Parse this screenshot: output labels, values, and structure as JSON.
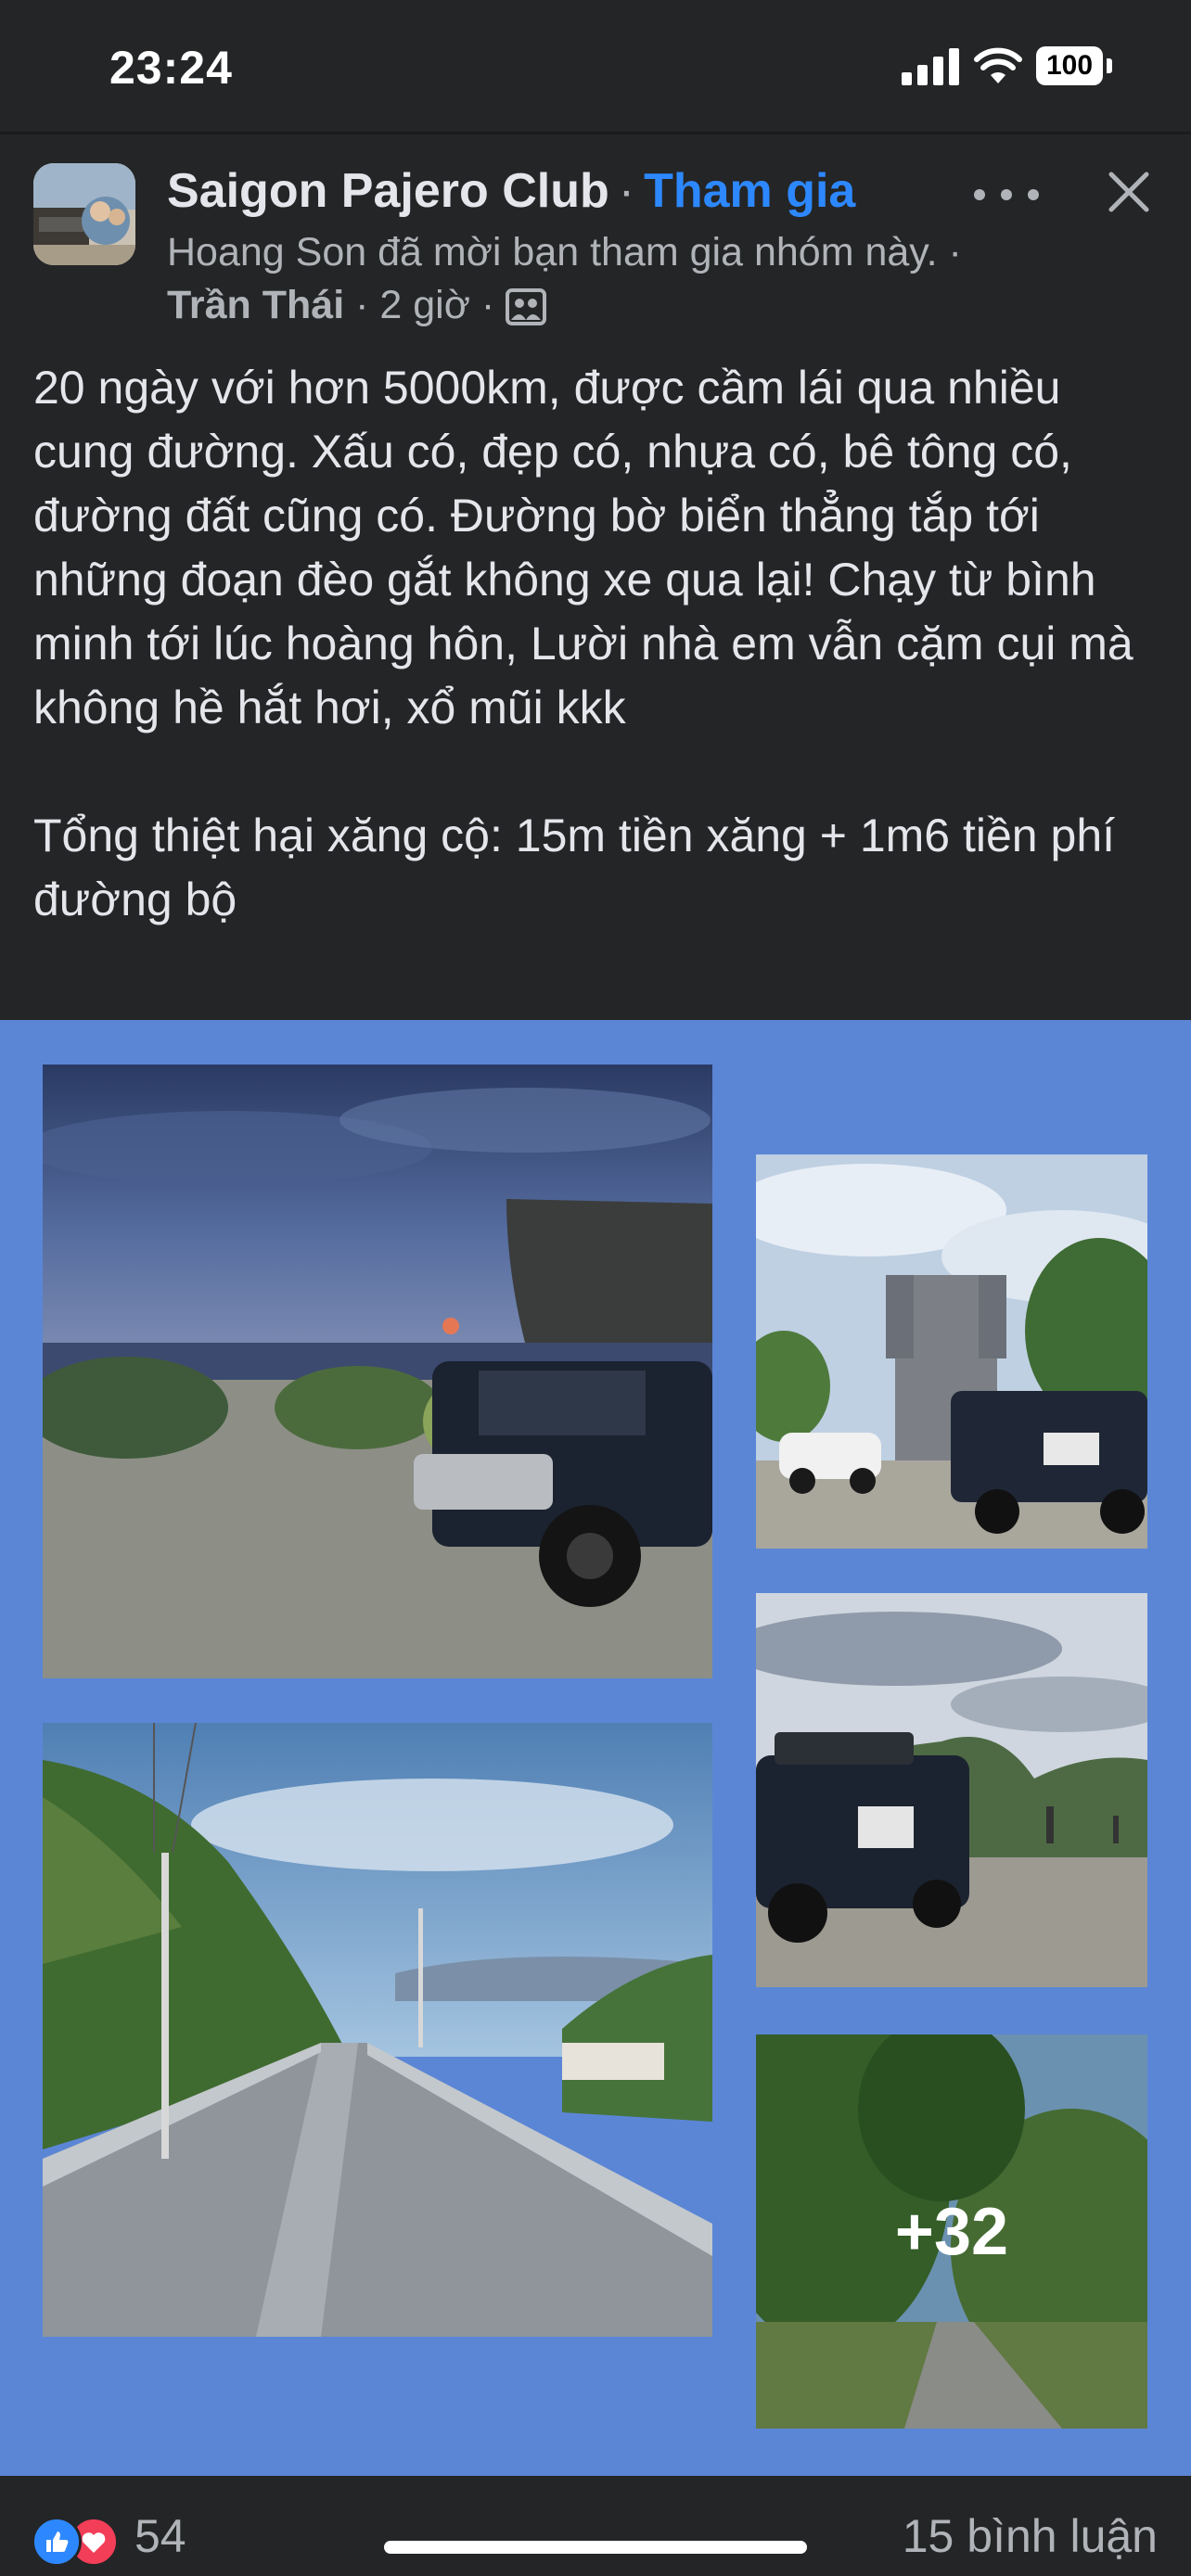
{
  "status_bar": {
    "time": "23:24",
    "battery": "100",
    "icons": [
      "signal-icon",
      "wifi-icon",
      "battery-icon"
    ]
  },
  "post": {
    "group_name": "Saigon Pajero Club",
    "separator": "·",
    "join_label": "Tham gia",
    "invite_text": "Hoang Son đã mời bạn tham gia nhóm này.",
    "meta_sep": "·",
    "author": "Trần Thái",
    "time_ago": "2 giờ",
    "audience_icon": "group-audience-icon",
    "body": "20 ngày với hơn 5000km, được cầm lái qua nhiều cung đường. Xấu có, đẹp có, nhựa có, bê tông có, đường đất cũng có. Đường bờ biển thẳng tắp tới những đoạn đèo gắt không xe qua lại! Chạy từ bình minh tới lúc hoàng hôn, Lười nhà em vẫn cặm cụi mà không hề hắt hơi, xổ mũi kkk\n\nTổng thiệt hại xăng cộ: 15m tiền xăng + 1m6 tiền phí đường bộ"
  },
  "photos": {
    "more_count_label": "+32",
    "background_color": "#5b86d6"
  },
  "footer": {
    "reaction_icons": [
      "like-icon",
      "love-icon"
    ],
    "reaction_count": "54",
    "comments_label": "15 bình luận"
  },
  "colors": {
    "background": "#242526",
    "link_blue": "#2d88ff",
    "text_primary": "#e4e6eb",
    "text_secondary": "#b0b3b8",
    "love_red": "#f33e58"
  }
}
